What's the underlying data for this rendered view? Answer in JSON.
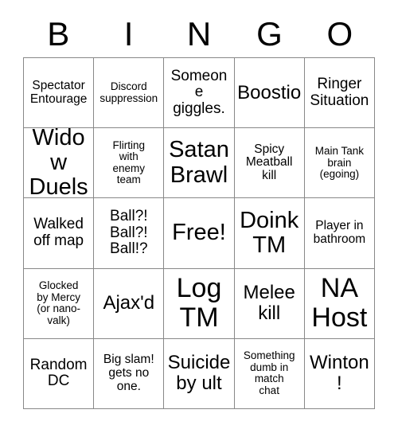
{
  "header": {
    "letters": [
      "B",
      "I",
      "N",
      "G",
      "O"
    ]
  },
  "grid": {
    "columns": 5,
    "rows": 5,
    "cells": [
      {
        "text": "Spectator\nEntourage",
        "size": "xs"
      },
      {
        "text": "Discord\nsuppression",
        "size": "xxs"
      },
      {
        "text": "Someone\ngiggles.",
        "size": "sm"
      },
      {
        "text": "Boostio",
        "size": "md"
      },
      {
        "text": "Ringer\nSituation",
        "size": "sm"
      },
      {
        "text": "Widow\nDuels",
        "size": "lg"
      },
      {
        "text": "Flirting\nwith\nenemy\nteam",
        "size": "xxs"
      },
      {
        "text": "Satan\nBrawl",
        "size": "lg"
      },
      {
        "text": "Spicy\nMeatball\nkill",
        "size": "xs"
      },
      {
        "text": "Main Tank\nbrain\n(egoing)",
        "size": "xxs"
      },
      {
        "text": "Walked\noff map",
        "size": "sm"
      },
      {
        "text": "Ball?!\nBall?!\nBall!?",
        "size": "sm"
      },
      {
        "text": "Free!",
        "size": "lg"
      },
      {
        "text": "Doink\nTM",
        "size": "lg"
      },
      {
        "text": "Player in\nbathroom",
        "size": "xs"
      },
      {
        "text": "Glocked\nby Mercy\n(or nano-\nvalk)",
        "size": "xxs"
      },
      {
        "text": "Ajax'd",
        "size": "md"
      },
      {
        "text": "Log\nTM",
        "size": "xl"
      },
      {
        "text": "Melee\nkill",
        "size": "md"
      },
      {
        "text": "NA\nHost",
        "size": "xl"
      },
      {
        "text": "Random\nDC",
        "size": "sm"
      },
      {
        "text": "Big slam!\ngets no\none.",
        "size": "xs"
      },
      {
        "text": "Suicide\nby ult",
        "size": "md"
      },
      {
        "text": "Something\ndumb in\nmatch\nchat",
        "size": "xxs"
      },
      {
        "text": "Winton!",
        "size": "md"
      }
    ]
  }
}
